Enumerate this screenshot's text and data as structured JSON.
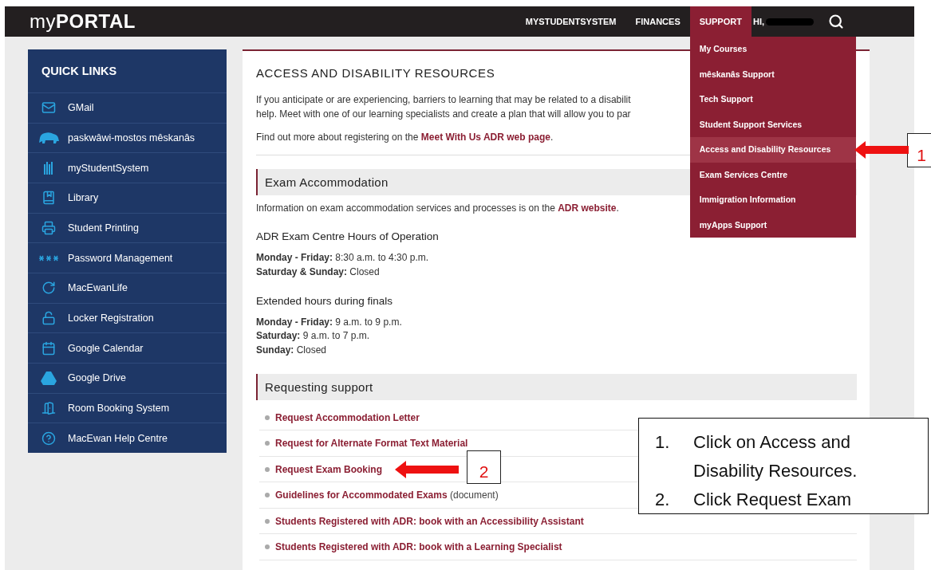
{
  "header": {
    "logo_light": "my",
    "logo_bold": "PORTAL",
    "nav": [
      {
        "label": "MYSTUDENTSYSTEM",
        "selected": false
      },
      {
        "label": "FINANCES",
        "selected": false
      },
      {
        "label": "SUPPORT",
        "selected": true
      }
    ],
    "greeting": "HI,"
  },
  "support_menu": [
    {
      "label": "My Courses",
      "selected": false
    },
    {
      "label": "mêskanâs Support",
      "selected": false
    },
    {
      "label": "Tech Support",
      "selected": false
    },
    {
      "label": "Student Support Services",
      "selected": false
    },
    {
      "label": "Access and Disability Resources",
      "selected": true
    },
    {
      "label": "Exam Services Centre",
      "selected": false
    },
    {
      "label": "Immigration Information",
      "selected": false
    },
    {
      "label": "myApps Support",
      "selected": false
    }
  ],
  "quick_links": {
    "title": "QUICK LINKS",
    "items": [
      {
        "label": "GMail",
        "kind": "mail"
      },
      {
        "label": "paskwâwi-mostos mêskanâs",
        "kind": "bison"
      },
      {
        "label": "myStudentSystem",
        "kind": "bars"
      },
      {
        "label": "Library",
        "kind": "book"
      },
      {
        "label": "Student Printing",
        "kind": "printer"
      },
      {
        "label": "Password Management",
        "kind": "asterisks"
      },
      {
        "label": "MacEwanLife",
        "kind": "swirl"
      },
      {
        "label": "Locker Registration",
        "kind": "lock"
      },
      {
        "label": "Google Calendar",
        "kind": "calendar"
      },
      {
        "label": "Google Drive",
        "kind": "drive"
      },
      {
        "label": "Room Booking System",
        "kind": "door"
      },
      {
        "label": "MacEwan Help Centre",
        "kind": "help"
      }
    ]
  },
  "content": {
    "title": "ACCESS AND DISABILITY RESOURCES",
    "intro_lines": [
      "If you anticipate or are experiencing, barriers to learning that may be related to a disabilit",
      "help. Meet with one of our learning specialists and create a plan that will allow you to par"
    ],
    "more": {
      "text": "Find out more about registering on the ",
      "link": "Meet With Us ADR web page",
      "after": "."
    },
    "exam_section": {
      "heading": "Exam Accommodation",
      "info": {
        "text": "Information on exam accommodation services and processes is on the ",
        "link": "ADR website",
        "after": "."
      },
      "hour_groups": [
        {
          "title": "ADR Exam Centre Hours of Operation",
          "lines": [
            "**Monday - Friday:** 8:30 a.m. to 4:30 p.m.",
            "**Saturday & Sunday:** Closed"
          ]
        },
        {
          "title": "Extended hours during finals",
          "lines": [
            "**Monday - Friday:** 9 a.m. to 9 p.m.",
            "**Saturday:** 9 a.m. to 7 p.m.",
            "**Sunday:** Closed"
          ]
        }
      ]
    },
    "request_section": {
      "heading": "Requesting support",
      "links": [
        {
          "link": "Request Accommodation Letter"
        },
        {
          "link": "Request for Alternate Format Text Material"
        },
        {
          "link": "Request Exam Booking"
        },
        {
          "link": "Guidelines for Accommodated Exams",
          "note": "(document)"
        },
        {
          "link": "Students Registered with ADR: book with an Accessibility Assistant"
        },
        {
          "link": "Students Registered with ADR: book with a Learning Specialist"
        }
      ]
    }
  },
  "annotations": {
    "markers": [
      {
        "label": "1"
      },
      {
        "label": "2"
      }
    ],
    "callout": [
      {
        "number": "1.",
        "text": "Click on Access and Disability Resources."
      },
      {
        "number": "2.",
        "text": "Click Request Exam"
      }
    ]
  }
}
